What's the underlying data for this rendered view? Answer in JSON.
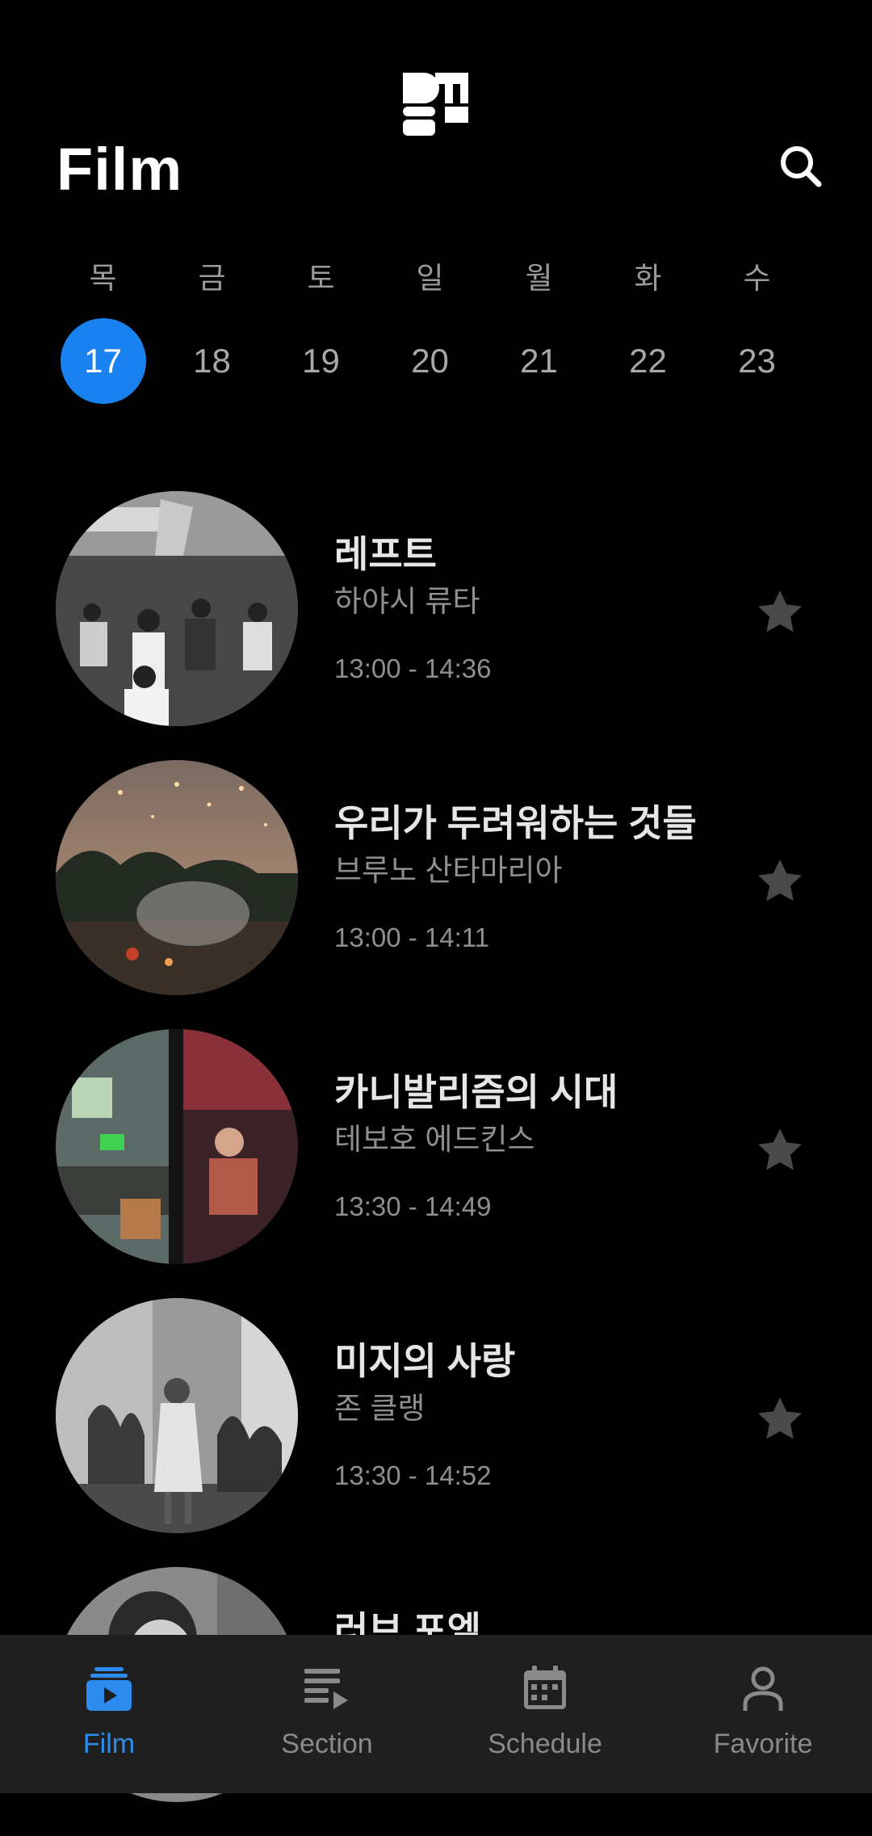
{
  "header": {
    "title": "Film",
    "logo_icon": "app-logo-icon",
    "search_icon": "search-icon"
  },
  "calendar": {
    "weekdays": [
      "목",
      "금",
      "토",
      "일",
      "월",
      "화",
      "수"
    ],
    "dates": [
      "17",
      "18",
      "19",
      "20",
      "21",
      "22",
      "23"
    ],
    "selected_index": 0,
    "selected_color": "#1a82f0"
  },
  "films": [
    {
      "title": "레프트",
      "director": "하야시 류타",
      "time": "13:00 - 14:36",
      "favorite_icon": "star-icon"
    },
    {
      "title": "우리가 두려워하는 것들",
      "director": "브루노 산타마리아",
      "time": "13:00 - 14:11",
      "favorite_icon": "star-icon"
    },
    {
      "title": "카니발리즘의 시대",
      "director": "테보호 에드킨스",
      "time": "13:30 - 14:49",
      "favorite_icon": "star-icon"
    },
    {
      "title": "미지의 사랑",
      "director": "존 클랭",
      "time": "13:30 - 14:52",
      "favorite_icon": "star-icon"
    },
    {
      "title": "러브 포엠",
      "director": "",
      "time": "",
      "favorite_icon": "star-icon"
    }
  ],
  "bottom_nav": {
    "items": [
      {
        "label": "Film",
        "icon": "film-icon",
        "active": true
      },
      {
        "label": "Section",
        "icon": "playlist-icon",
        "active": false
      },
      {
        "label": "Schedule",
        "icon": "calendar-icon",
        "active": false
      },
      {
        "label": "Favorite",
        "icon": "person-icon",
        "active": false
      }
    ],
    "active_color": "#2d8cf0"
  }
}
